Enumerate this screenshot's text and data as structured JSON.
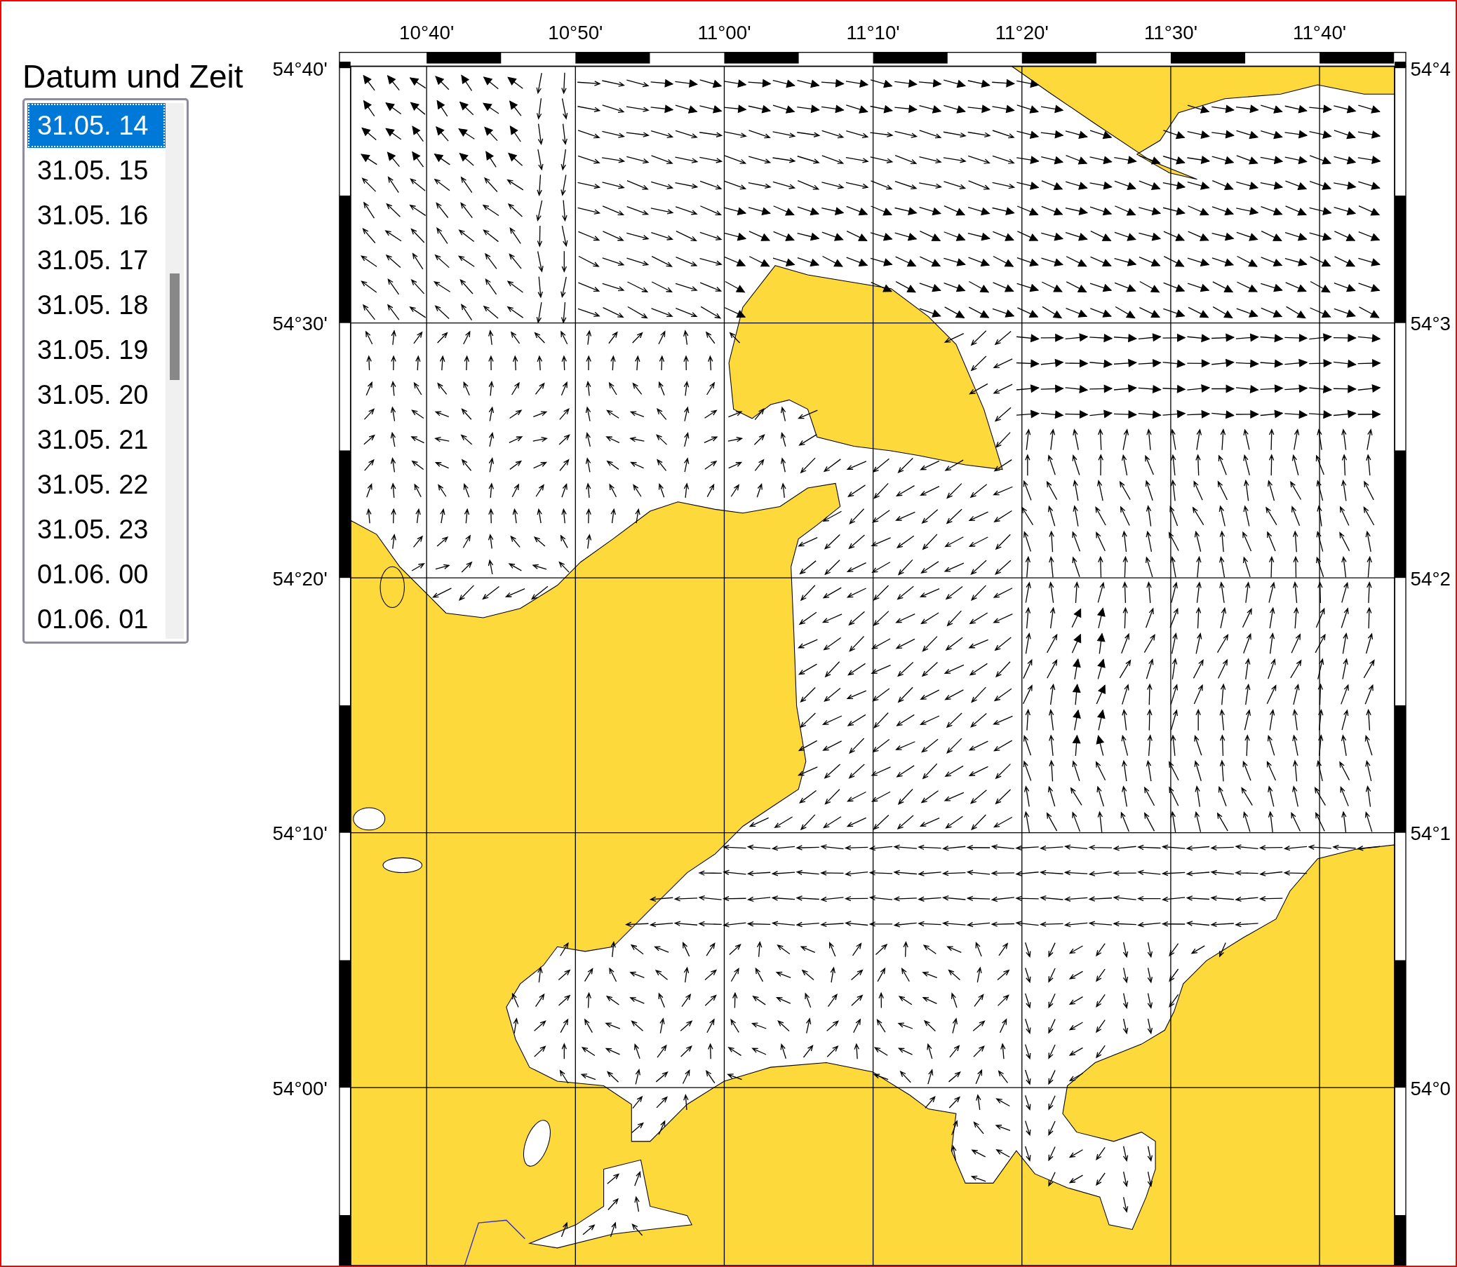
{
  "panel": {
    "title": "Datum und Zeit",
    "times": [
      {
        "label": "31.05. 14",
        "selected": true
      },
      {
        "label": "31.05. 15",
        "selected": false
      },
      {
        "label": "31.05. 16",
        "selected": false
      },
      {
        "label": "31.05. 17",
        "selected": false
      },
      {
        "label": "31.05. 18",
        "selected": false
      },
      {
        "label": "31.05. 19",
        "selected": false
      },
      {
        "label": "31.05. 20",
        "selected": false
      },
      {
        "label": "31.05. 21",
        "selected": false
      },
      {
        "label": "31.05. 22",
        "selected": false
      },
      {
        "label": "31.05. 23",
        "selected": false
      },
      {
        "label": "01.06. 00",
        "selected": false
      },
      {
        "label": "01.06. 01",
        "selected": false
      }
    ]
  },
  "map": {
    "top_labels": [
      "10°40'",
      "10°50'",
      "11°00'",
      "11°10'",
      "11°20'",
      "11°30'",
      "11°40'"
    ],
    "left_labels": [
      "54°40'",
      "54°30'",
      "54°20'",
      "54°10'",
      "54°00'"
    ],
    "right_labels": [
      "54°4",
      "54°3",
      "54°2",
      "54°1",
      "54°0"
    ]
  }
}
